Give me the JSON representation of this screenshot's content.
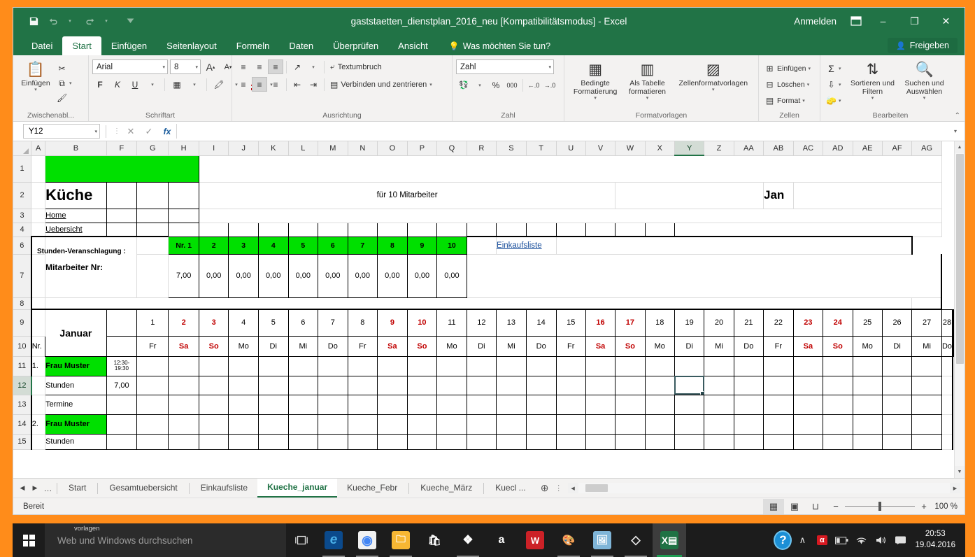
{
  "window": {
    "title": "gaststaetten_dienstplan_2016_neu [Kompatibilitätsmodus] - Excel",
    "signin": "Anmelden",
    "minimize": "–",
    "restore": "❐",
    "close": "✕",
    "ribbon_display_icon": "ribbon-display-options"
  },
  "qat": {
    "save": "save-icon",
    "undo": "undo-icon",
    "redo": "redo-icon",
    "customize": "customize-icon"
  },
  "ribbon": {
    "tabs": [
      {
        "label": "Datei",
        "active": false
      },
      {
        "label": "Start",
        "active": true
      },
      {
        "label": "Einfügen",
        "active": false
      },
      {
        "label": "Seitenlayout",
        "active": false
      },
      {
        "label": "Formeln",
        "active": false
      },
      {
        "label": "Daten",
        "active": false
      },
      {
        "label": "Überprüfen",
        "active": false
      },
      {
        "label": "Ansicht",
        "active": false
      }
    ],
    "tellme": "Was möchten Sie tun?",
    "share": "Freigeben",
    "groups": {
      "clipboard": {
        "label": "Zwischenabl...",
        "paste": "Einfügen",
        "cut": "cut-icon",
        "copy": "copy-icon",
        "format_painter": "format-painter-icon"
      },
      "font": {
        "label": "Schriftart",
        "font_name": "Arial",
        "font_size": "8",
        "grow": "A",
        "shrink": "A",
        "bold": "F",
        "italic": "K",
        "underline": "U",
        "borders": "borders-icon",
        "fill_color": "fill-color-icon",
        "font_color": "A"
      },
      "alignment": {
        "label": "Ausrichtung",
        "wrap_text": "Textumbruch",
        "merge_center": "Verbinden und zentrieren",
        "orientation": "orientation-icon",
        "indent_dec": "decrease-indent-icon",
        "indent_inc": "increase-indent-icon"
      },
      "number": {
        "label": "Zahl",
        "format": "Zahl",
        "accounting": "accounting-icon",
        "percent": "%",
        "thousands": "000",
        "inc_dec": "←.0",
        "dec_dec": "→.0"
      },
      "styles": {
        "label": "Formatvorlagen",
        "conditional": "Bedingte Formatierung",
        "as_table": "Als Tabelle formatieren",
        "cell_styles": "Zellenformatvorlagen"
      },
      "cells": {
        "label": "Zellen",
        "insert": "Einfügen",
        "delete": "Löschen",
        "format": "Format"
      },
      "editing": {
        "label": "Bearbeiten",
        "autosum": "Σ",
        "fill": "fill-icon",
        "clear": "clear-icon",
        "sort_filter": "Sortieren und Filtern",
        "find_select": "Suchen und Auswählen"
      }
    }
  },
  "formulabar": {
    "namebox": "Y12",
    "cancel": "✕",
    "confirm": "✓",
    "fx": "fx",
    "value": ""
  },
  "grid": {
    "columns": [
      "A",
      "B",
      "F",
      "G",
      "H",
      "I",
      "J",
      "K",
      "L",
      "M",
      "N",
      "O",
      "P",
      "Q",
      "R",
      "S",
      "T",
      "U",
      "V",
      "W",
      "X",
      "Y",
      "Z",
      "AA",
      "AB",
      "AC",
      "AD",
      "AE",
      "AF",
      "AG"
    ],
    "selected_column": "Y",
    "selected_row": "12",
    "rows": [
      "1",
      "2",
      "3",
      "4",
      "6",
      "7",
      "8",
      "9",
      "10",
      "11",
      "12",
      "13",
      "14",
      "15"
    ],
    "cells": {
      "kueche": "Küche",
      "home": "Home",
      "uebersicht": "Uebersicht",
      "fuer_mitarbeiter": "für 10 Mitarbeiter",
      "monat_kurz": "Jan",
      "mitarbeiter_nr_label": "Mitarbeiter Nr:",
      "stunden_veranschlagung_label": "Stunden-Veranschlagung :",
      "einkaufsliste_link": "Einkaufsliste",
      "mitarbeiter_nummern": [
        "Nr. 1",
        "2",
        "3",
        "4",
        "5",
        "6",
        "7",
        "8",
        "9",
        "10"
      ],
      "stunden_werte": [
        "7,00",
        "0,00",
        "0,00",
        "0,00",
        "0,00",
        "0,00",
        "0,00",
        "0,00",
        "0,00",
        "0,00"
      ],
      "monat": "Januar",
      "nr_label": "Nr.",
      "tage": [
        1,
        2,
        3,
        4,
        5,
        6,
        7,
        8,
        9,
        10,
        11,
        12,
        13,
        14,
        15,
        16,
        17,
        18,
        19,
        20,
        21,
        22,
        23,
        24,
        25,
        26,
        27,
        28
      ],
      "wochentage": [
        "Fr",
        "Sa",
        "So",
        "Mo",
        "Di",
        "Mi",
        "Do",
        "Fr",
        "Sa",
        "So",
        "Mo",
        "Di",
        "Mi",
        "Do",
        "Fr",
        "Sa",
        "So",
        "Mo",
        "Di",
        "Mi",
        "Do",
        "Fr",
        "Sa",
        "So",
        "Mo",
        "Di",
        "Mi",
        "Do"
      ],
      "weekend_flags": [
        false,
        true,
        true,
        false,
        false,
        false,
        false,
        false,
        true,
        true,
        false,
        false,
        false,
        false,
        false,
        true,
        true,
        false,
        false,
        false,
        false,
        false,
        true,
        true,
        false,
        false,
        false,
        false
      ],
      "employee_rows": [
        {
          "nr": "1.",
          "name": "Frau Muster",
          "shift": "12:30-\n19:30"
        },
        {
          "nr": "",
          "name": "Stunden",
          "value": "7,00"
        },
        {
          "nr": "",
          "name": "Termine",
          "value": ""
        },
        {
          "nr": "2.",
          "name": "Frau Muster",
          "shift": ""
        },
        {
          "nr": "",
          "name": "Stunden",
          "value": ""
        }
      ]
    },
    "colors": {
      "green": "#00e000",
      "weekend_red": "#c00000",
      "accent": "#217346"
    }
  },
  "sheettabs": {
    "first": "◀",
    "last": "▶",
    "more": "…",
    "tabs": [
      {
        "label": "Start",
        "active": false
      },
      {
        "label": "Gesamtuebersicht",
        "active": false
      },
      {
        "label": "Einkaufsliste",
        "active": false
      },
      {
        "label": "Kueche_januar",
        "active": true
      },
      {
        "label": "Kueche_Febr",
        "active": false
      },
      {
        "label": "Kueche_März",
        "active": false
      },
      {
        "label": "Kuecl ...",
        "active": false
      }
    ],
    "add": "⊕"
  },
  "statusbar": {
    "status": "Bereit",
    "view_normal": "normal-view-icon",
    "view_layout": "page-layout-icon",
    "view_break": "page-break-icon",
    "zoom_out": "−",
    "zoom_in": "+",
    "zoom": "100 %"
  },
  "taskbar": {
    "start": "windows-start-icon",
    "search_label": "vorlagen",
    "search_placeholder": "Web und Windows durchsuchen",
    "task_view": "task-view-icon",
    "apps": [
      {
        "name": "edge",
        "glyph": "e",
        "bg": "#0b4a8c",
        "color": "#4ab0e8",
        "running": true
      },
      {
        "name": "chrome",
        "glyph": "◉",
        "bg": "#f5f5f5",
        "color": "#4285f4",
        "running": true
      },
      {
        "name": "file-explorer",
        "glyph": "🗀",
        "bg": "#f7b733",
        "color": "#fff",
        "running": true
      },
      {
        "name": "windows-store",
        "glyph": "🛍",
        "bg": "#2b2b2b",
        "color": "#fff",
        "running": false
      },
      {
        "name": "dropbox",
        "glyph": "❖",
        "bg": "#1c1c1c",
        "color": "#fff",
        "running": true
      },
      {
        "name": "amazon",
        "glyph": "a",
        "bg": "#1c1c1c",
        "color": "#fff",
        "running": false
      },
      {
        "name": "wordpress",
        "glyph": "W",
        "bg": "#cc2127",
        "color": "#fff",
        "running": false
      },
      {
        "name": "paint",
        "glyph": "🎨",
        "bg": "#1c1c1c",
        "color": "#d8d8d8",
        "running": true
      },
      {
        "name": "photos",
        "glyph": "⬜",
        "bg": "#7fb5d8",
        "color": "#fff",
        "running": true
      },
      {
        "name": "visual-studio-code",
        "glyph": "◇",
        "bg": "#1c1c1c",
        "color": "#e8e8e8",
        "running": true
      },
      {
        "name": "excel",
        "glyph": "X",
        "bg": "#1f7244",
        "color": "#fff",
        "running": true,
        "active": true
      }
    ],
    "tray": {
      "help": "?",
      "expand": "∧",
      "antivirus": "antivirus-icon",
      "battery": "battery-icon",
      "wifi": "wifi-icon",
      "volume": "volume-icon",
      "action_center": "action-center-icon"
    },
    "time": "20:53",
    "date": "19.04.2016"
  }
}
